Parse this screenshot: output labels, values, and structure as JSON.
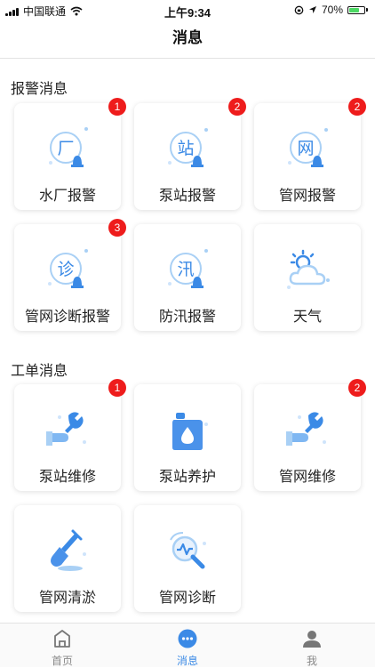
{
  "status": {
    "carrier": "中国联通",
    "time": "上午9:34",
    "battery": "70%"
  },
  "nav": {
    "title": "消息"
  },
  "alarm_section": {
    "title": "报警消息",
    "items": [
      {
        "label": "水厂报警",
        "badge": "1",
        "glyph": "厂"
      },
      {
        "label": "泵站报警",
        "badge": "2",
        "glyph": "站"
      },
      {
        "label": "管网报警",
        "badge": "2",
        "glyph": "网"
      },
      {
        "label": "管网诊断报警",
        "badge": "3",
        "glyph": "诊"
      },
      {
        "label": "防汛报警",
        "glyph": "汛"
      },
      {
        "label": "天气"
      }
    ]
  },
  "work_section": {
    "title": "工单消息",
    "items": [
      {
        "label": "泵站维修",
        "badge": "1"
      },
      {
        "label": "泵站养护"
      },
      {
        "label": "管网维修",
        "badge": "2"
      },
      {
        "label": "管网清淤"
      },
      {
        "label": "管网诊断"
      }
    ]
  },
  "tabs": [
    {
      "label": "首页",
      "icon": "home-icon"
    },
    {
      "label": "消息",
      "icon": "message-icon",
      "active": true
    },
    {
      "label": "我",
      "icon": "profile-icon"
    }
  ],
  "colors": {
    "accent": "#3b8ae6",
    "badge": "#ee1c1c",
    "icon_light": "#a9d0f5",
    "icon_dark": "#3b8ae6"
  }
}
